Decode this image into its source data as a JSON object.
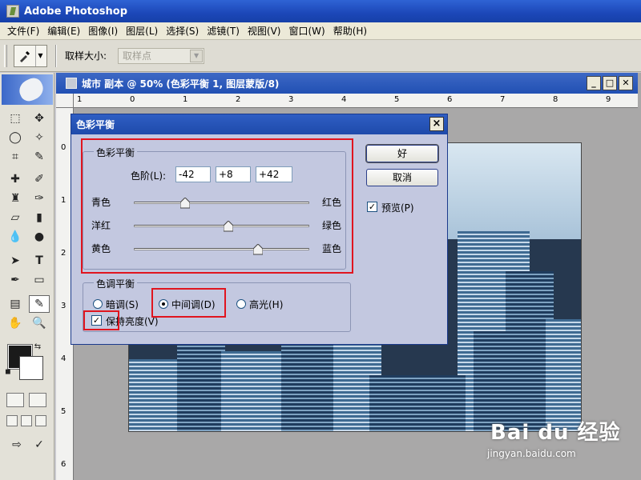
{
  "app": {
    "title": "Adobe Photoshop"
  },
  "menu": [
    "文件(F)",
    "编辑(E)",
    "图像(I)",
    "图层(L)",
    "选择(S)",
    "滤镜(T)",
    "视图(V)",
    "窗口(W)",
    "帮助(H)"
  ],
  "options_bar": {
    "sample_size_label": "取样大小:",
    "sample_size_value": "取样点"
  },
  "document": {
    "title": "城市 副本 @ 50% (色彩平衡 1, 图层蒙版/8)",
    "ruler_top": [
      "1",
      "0",
      "1",
      "2",
      "3",
      "4",
      "5",
      "6",
      "7",
      "8",
      "9"
    ],
    "ruler_left": [
      "0",
      "1",
      "2",
      "3",
      "4",
      "5",
      "6"
    ]
  },
  "dialog": {
    "title": "色彩平衡",
    "close": "×",
    "color_balance_group": "色彩平衡",
    "levels_label": "色阶(L):",
    "levels": [
      "-42",
      "+8",
      "+42"
    ],
    "sliders": [
      {
        "left": "青色",
        "right": "红色",
        "value": -42
      },
      {
        "left": "洋红",
        "right": "绿色",
        "value": 8
      },
      {
        "left": "黄色",
        "right": "蓝色",
        "value": 42
      }
    ],
    "tone_group": "色调平衡",
    "tones": [
      {
        "label": "暗调(S)",
        "selected": false
      },
      {
        "label": "中间调(D)",
        "selected": true
      },
      {
        "label": "高光(H)",
        "selected": false
      }
    ],
    "preserve_luminosity_label": "保持亮度(V)",
    "preserve_luminosity": true,
    "ok_label": "好",
    "cancel_label": "取消",
    "preview_label": "预览(P)",
    "preview": true
  },
  "watermark": {
    "main": "Bai du 经验",
    "sub": "jingyan.baidu.com"
  },
  "colors": {
    "highlight": "#e0151f",
    "title_blue": "#2150b3",
    "foreground": "#1a1a1a",
    "background": "#ffffff"
  }
}
